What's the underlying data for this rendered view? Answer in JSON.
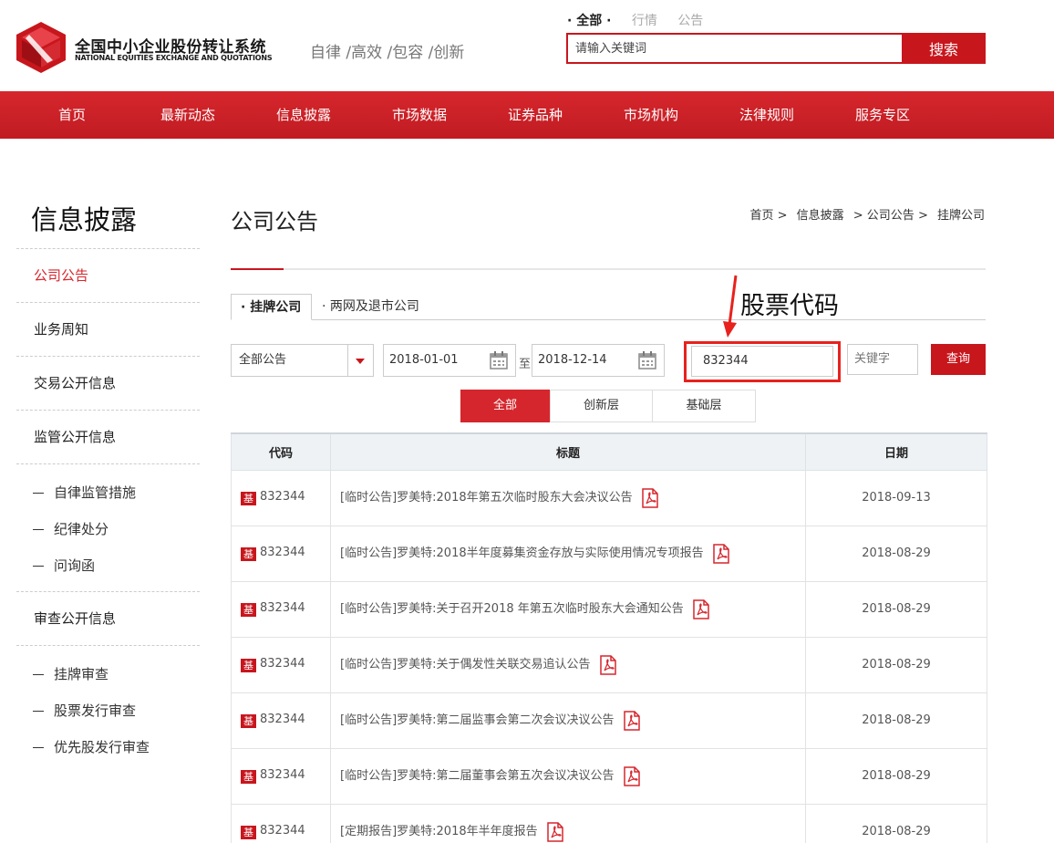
{
  "header": {
    "logo_cn": "全国中小企业股份转让系统",
    "logo_en": "NATIONAL EQUITIES EXCHANGE AND QUOTATIONS",
    "slogan": "自律 /高效 /包容 /创新",
    "scope_tabs": [
      "全部",
      "行情",
      "公告"
    ],
    "search_placeholder": "请输入关键词",
    "search_button": "搜索",
    "brand_color": "#c8161d"
  },
  "nav": [
    "首页",
    "最新动态",
    "信息披露",
    "市场数据",
    "证券品种",
    "市场机构",
    "法律规则",
    "服务专区"
  ],
  "sidebar": {
    "title": "信息披露",
    "items": [
      "公司公告",
      "业务周知",
      "交易公开信息",
      "监管公开信息"
    ],
    "regulation_sub": [
      "自律监管措施",
      "纪律处分",
      "问询函"
    ],
    "review_title": "审查公开信息",
    "review_sub": [
      "挂牌审查",
      "股票发行审查",
      "优先股发行审查"
    ]
  },
  "main": {
    "title": "公司公告",
    "breadcrumb": [
      "首页 >",
      "信息披露",
      "> 公司公告 >",
      "挂牌公司"
    ],
    "tabs": [
      "· 挂牌公司",
      "· 两网及退市公司"
    ],
    "annotation": "股票代码",
    "filter": {
      "type": "全部公告",
      "date_from": "2018-01-01",
      "date_sep": "至",
      "date_to": "2018-12-14",
      "code": "832344",
      "keyword_placeholder": "关键字",
      "query_button": "查询"
    },
    "segments": [
      "全部",
      "创新层",
      "基础层"
    ],
    "table": {
      "headers": [
        "代码",
        "标题",
        "日期"
      ],
      "badge": "基",
      "rows": [
        {
          "code": "832344",
          "title": "[临时公告]罗美特:2018年第五次临时股东大会决议公告",
          "date": "2018-09-13"
        },
        {
          "code": "832344",
          "title": "[临时公告]罗美特:2018半年度募集资金存放与实际使用情况专项报告",
          "date": "2018-08-29"
        },
        {
          "code": "832344",
          "title": "[临时公告]罗美特:关于召开2018 年第五次临时股东大会通知公告",
          "date": "2018-08-29"
        },
        {
          "code": "832344",
          "title": "[临时公告]罗美特:关于偶发性关联交易追认公告",
          "date": "2018-08-29"
        },
        {
          "code": "832344",
          "title": "[临时公告]罗美特:第二届监事会第二次会议决议公告",
          "date": "2018-08-29"
        },
        {
          "code": "832344",
          "title": "[临时公告]罗美特:第二届董事会第五次会议决议公告",
          "date": "2018-08-29"
        },
        {
          "code": "832344",
          "title": "[定期报告]罗美特:2018年半年度报告",
          "date": "2018-08-29"
        }
      ]
    }
  }
}
